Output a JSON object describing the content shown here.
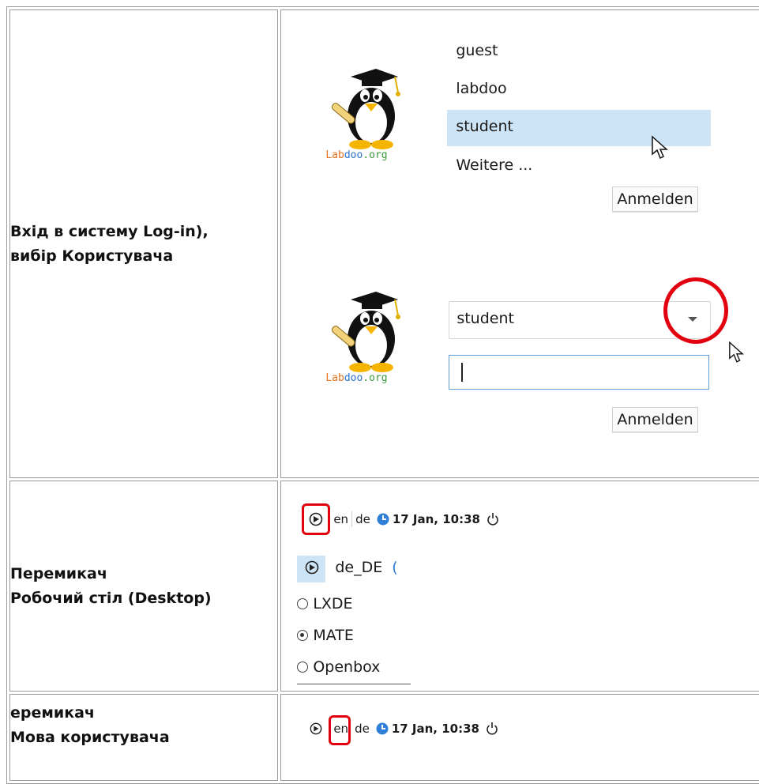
{
  "rows": [
    {
      "label_lines": [
        "Вхід в систему Log-in),",
        "вибір Користувача"
      ]
    },
    {
      "label_lines": [
        "Перемикач",
        "Робочий стіл (Desktop)"
      ]
    },
    {
      "label_lines": [
        "еремикач",
        "Мова користувача"
      ]
    }
  ],
  "login": {
    "users": [
      "guest",
      "labdoo",
      "student",
      "Weitere ..."
    ],
    "selected_user": "student",
    "combo_value": "student",
    "login_button": "Anmelden",
    "logo": {
      "part1": "Lab",
      "part2": "doo",
      "part3": ".org"
    }
  },
  "panel": {
    "lang_en": "en",
    "lang_de": "de",
    "datetime": "17 Jan, 10:38"
  },
  "session_menu": {
    "header": "de_DE",
    "items": [
      {
        "label": "LXDE",
        "checked": false
      },
      {
        "label": "MATE",
        "checked": true
      },
      {
        "label": "Openbox",
        "checked": false
      }
    ]
  },
  "colors": {
    "highlight": "#cde4f7",
    "annotation": "#e3000f",
    "focus": "#5b9bd5",
    "clock": "#2f7fd6"
  }
}
